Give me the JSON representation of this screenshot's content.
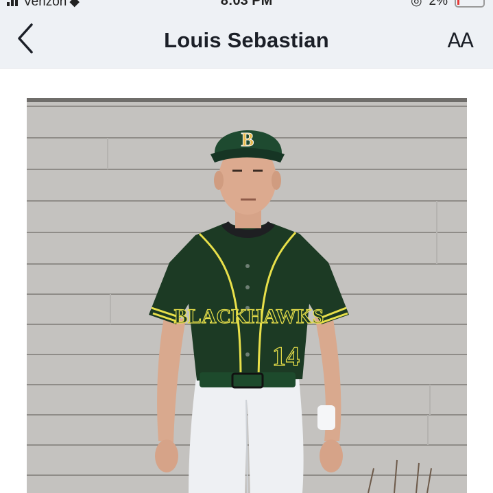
{
  "status_bar": {
    "carrier": "Verizon",
    "time": "8:03 PM",
    "battery": "2%"
  },
  "nav": {
    "title": "Louis Sebastian",
    "back_icon": "chevron-left-icon",
    "text_size_label": "AA"
  },
  "photo": {
    "subject": "baseball-player-portrait",
    "jersey_text": "BLACKHAWKS",
    "jersey_number": "14",
    "cap_letter": "B",
    "colors": {
      "siding": "#c2c0bd",
      "jersey": "#1c3a24",
      "trim": "#e8e04a",
      "pants": "#eef0f3",
      "belt": "#1d4a2c"
    }
  }
}
